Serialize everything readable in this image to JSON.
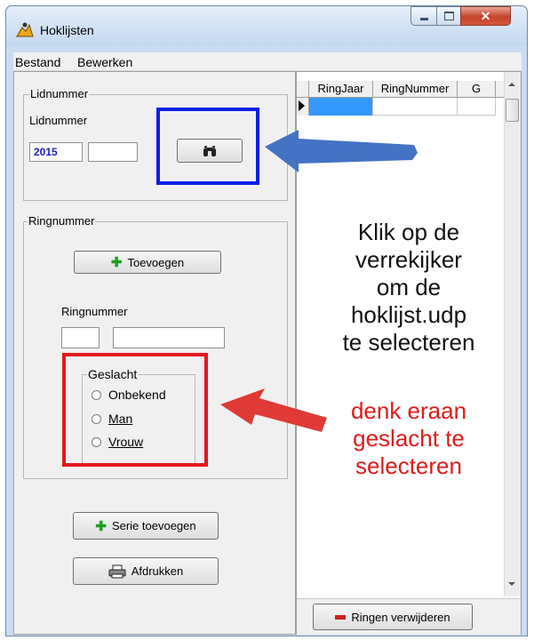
{
  "window": {
    "title": "Hoklijsten"
  },
  "menu": [
    "Bestand",
    "Bewerken"
  ],
  "lidnummer": {
    "group_title": "Lidnummer",
    "label": "Lidnummer",
    "field1_value": "2015",
    "field2_value": ""
  },
  "ringnummer": {
    "group_title": "Ringnummer",
    "add_button": "Toevoegen",
    "label": "Ringnummer",
    "field1_value": "",
    "field2_value": ""
  },
  "geslacht": {
    "group_title": "Geslacht",
    "options": [
      "Onbekend",
      "Man",
      "Vrouw"
    ]
  },
  "buttons": {
    "serie": "Serie toevoegen",
    "print": "Afdrukken",
    "remove": "Ringen verwijderen"
  },
  "grid": {
    "columns": [
      "RingJaar",
      "RingNummer",
      "G"
    ]
  },
  "annotations": {
    "instruction_lines": [
      "Klik op de",
      "verrekijker",
      "om de",
      "hoklijst.udp",
      "te selecteren"
    ],
    "reminder_lines": [
      "denk eraan",
      "geslacht te",
      "selecteren"
    ]
  },
  "colors": {
    "highlight_blue": "#0a1ee8",
    "highlight_red": "#e5171c",
    "arrow_blue": "#4472c4",
    "arrow_red": "#e03a36",
    "reminder_text": "#e01b1b"
  }
}
